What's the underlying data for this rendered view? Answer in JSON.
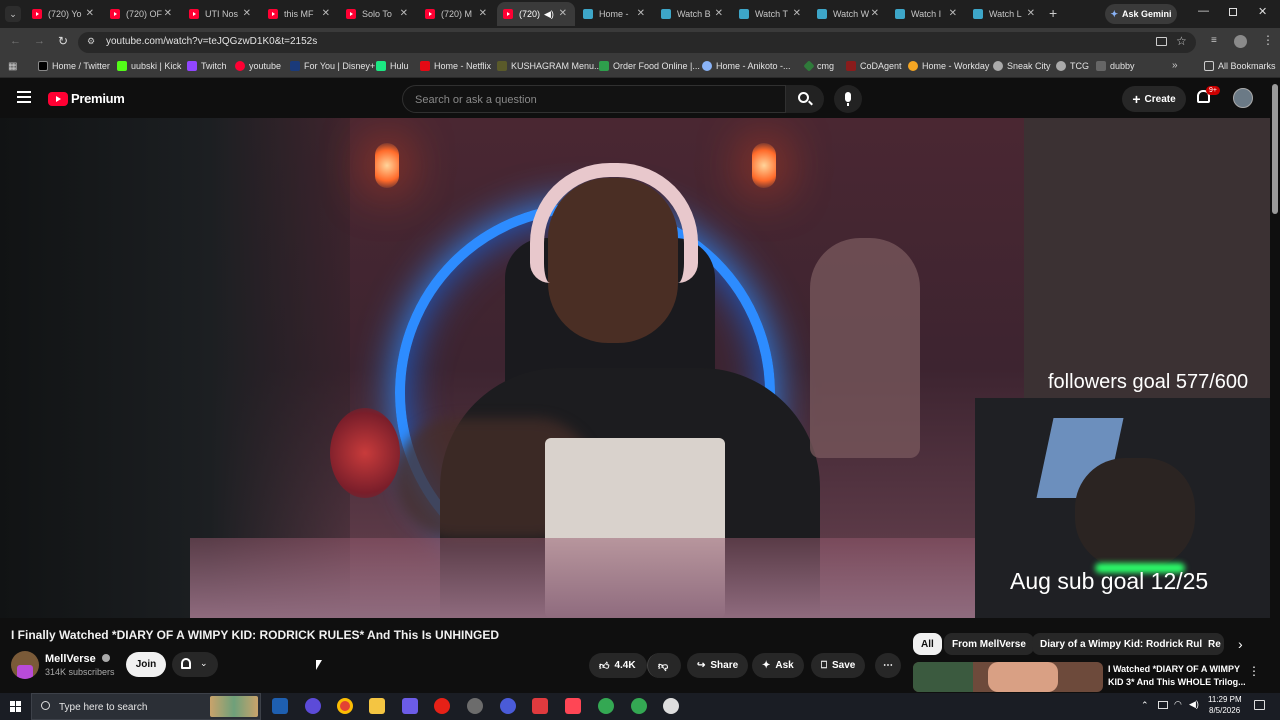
{
  "browser": {
    "tabs": [
      {
        "title": "(720) Yo",
        "icon": "youtube-icon"
      },
      {
        "title": "(720) OF",
        "icon": "youtube-icon"
      },
      {
        "title": "UTI Nos",
        "icon": "youtube-icon"
      },
      {
        "title": "this MF",
        "icon": "youtube-icon"
      },
      {
        "title": "Solo To",
        "icon": "youtube-icon"
      },
      {
        "title": "(720) M",
        "icon": "youtube-icon"
      },
      {
        "title": "(720)",
        "icon": "youtube-icon",
        "active": true
      },
      {
        "title": "Home -",
        "icon": "globe-icon"
      },
      {
        "title": "Watch B",
        "icon": "globe-icon"
      },
      {
        "title": "Watch T",
        "icon": "globe-icon"
      },
      {
        "title": "Watch W",
        "icon": "globe-icon"
      },
      {
        "title": "Watch I",
        "icon": "globe-icon"
      },
      {
        "title": "Watch L",
        "icon": "globe-icon"
      }
    ],
    "ask_gemini": "Ask Gemini",
    "url": "youtube.com/watch?v=teJQGzwD1K0&t=2152s",
    "bookmarks": [
      "Home / Twitter",
      "uubski | Kick",
      "Twitch",
      "youtube",
      "For You | Disney+",
      "Hulu",
      "Home - Netflix",
      "KUSHAGRAM Menu...",
      "Order Food Online |...",
      "Home - Anikoto -...",
      "cmg",
      "CoDAgent",
      "Home - Workday",
      "Sneak City",
      "TCG",
      "dubby"
    ],
    "all_bookmarks": "All Bookmarks"
  },
  "youtube": {
    "logo_text": "Premium",
    "search_placeholder": "Search or ask a question",
    "create_label": "Create",
    "notif_badge": "9+",
    "video": {
      "overlay_followers": "followers goal 577/600",
      "overlay_subs": "Aug sub goal 12/25"
    },
    "title": "I Finally Watched *DIARY OF A WIMPY KID: RODRICK RULES* And This Is UNHINGED",
    "channel": {
      "name": "MellVerse",
      "subs": "314K subscribers"
    },
    "join_label": "Join",
    "actions": {
      "likes": "4.4K",
      "share": "Share",
      "ask": "Ask",
      "save": "Save"
    },
    "chips": [
      "All",
      "From MellVerse",
      "Diary of a Wimpy Kid: Rodrick Rules",
      "Re"
    ],
    "recommended": {
      "title": "I Watched *DIARY OF A WIMPY KID 3* And This WHOLE Trilog..."
    }
  },
  "taskbar": {
    "search_placeholder": "Type here to search",
    "time": "11:29 PM",
    "date": "8/5/2026"
  },
  "colors": {
    "youtube_red": "#ff0033",
    "background": "#0f0f0f",
    "chip_bg": "#272727"
  }
}
